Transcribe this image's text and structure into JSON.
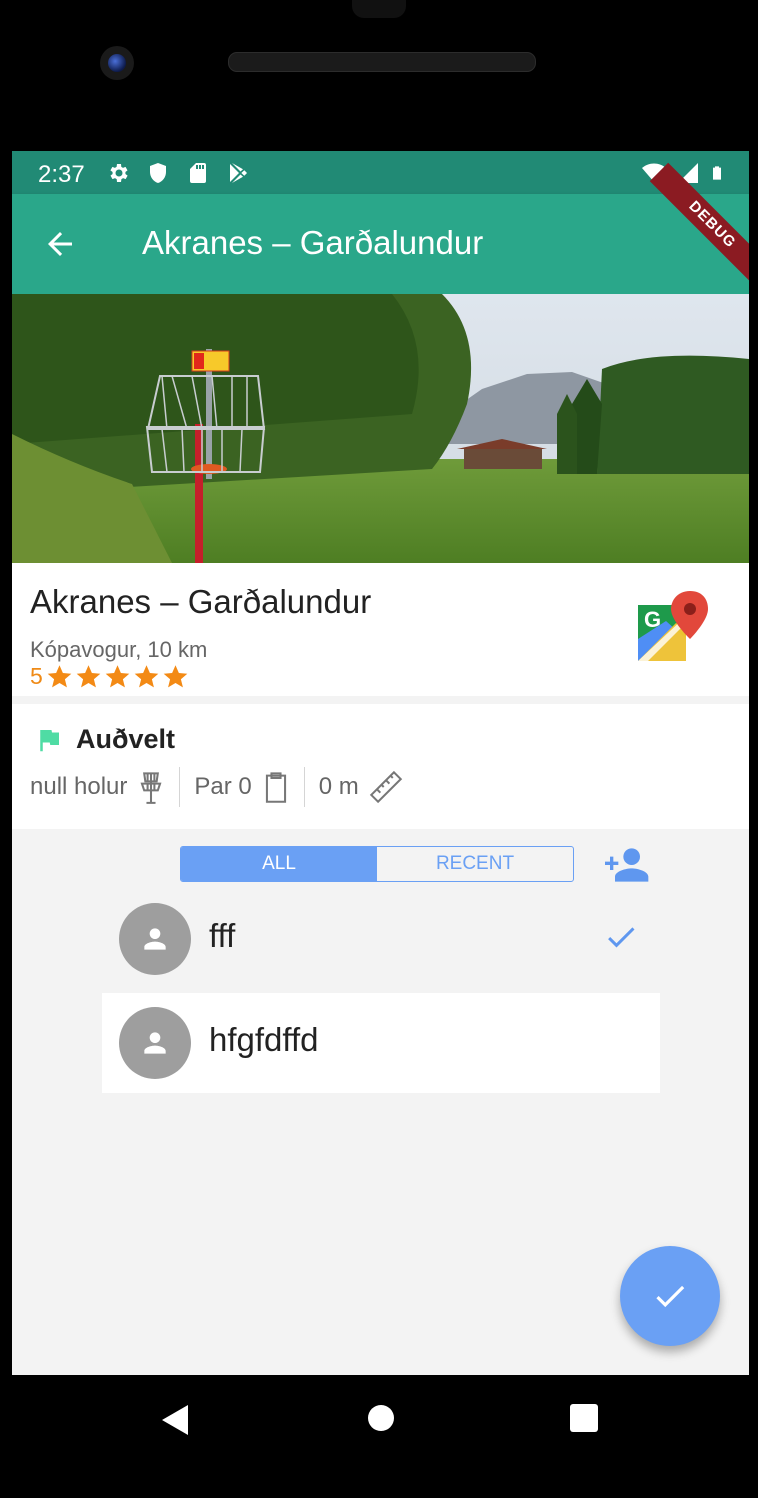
{
  "status_bar": {
    "time": "2:37",
    "left_icons": [
      "settings-icon",
      "shield-icon",
      "sd-card-icon",
      "play-store-icon"
    ],
    "right_icons": [
      "wifi-icon",
      "signal-icon",
      "battery-icon"
    ]
  },
  "app_bar": {
    "title": "Akranes – Garðalundur",
    "debug_banner": "DEBUG",
    "colors": {
      "appbar": "#2aa78a",
      "statusbar": "#218a75"
    }
  },
  "course": {
    "name": "Akranes – Garðalundur",
    "location": "Kópavogur, 10 km",
    "rating_value": "5",
    "stars": 5,
    "star_color": "#f38a15"
  },
  "details": {
    "difficulty": "Auðvelt",
    "holes": "null holur",
    "par": "Par 0",
    "distance": "0 m"
  },
  "players_panel": {
    "tabs": [
      {
        "label": "ALL",
        "active": true
      },
      {
        "label": "RECENT",
        "active": false
      }
    ],
    "players": [
      {
        "name": "fff",
        "selected": true
      },
      {
        "name": "hfgfdffd",
        "selected": false
      }
    ],
    "accent": "#6aa0f4"
  }
}
